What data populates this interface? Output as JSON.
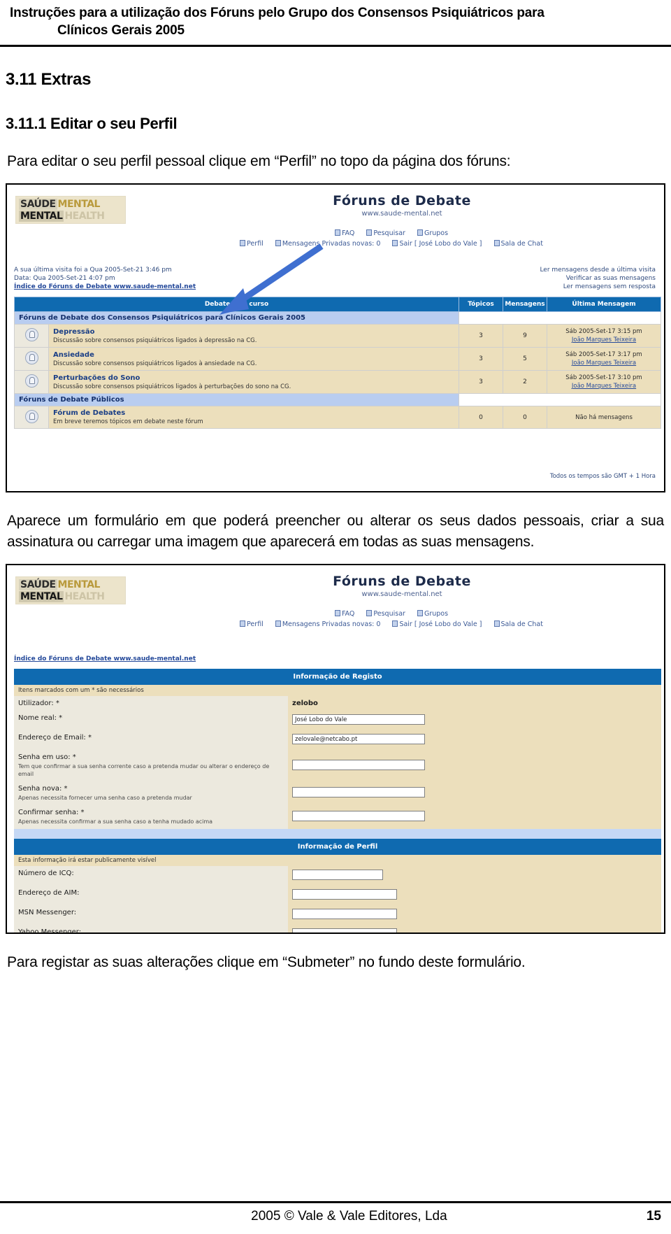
{
  "doc_header": {
    "line1": "Instruções para a utilização dos Fóruns pelo Grupo dos Consensos Psiquiátricos para",
    "line2": "Clínicos Gerais 2005"
  },
  "sections": {
    "h2": "3.11 Extras",
    "h3": "3.11.1 Editar o seu Perfil",
    "para1": "Para editar o seu perfil pessoal clique em “Perfil” no topo da página dos fóruns:",
    "para2": "Aparece um formulário em que poderá preencher ou alterar os seus dados pessoais, criar a sua assinatura ou carregar uma imagem que aparecerá em todas as suas mensagens.",
    "para3": "Para registar as suas alterações clique em “Submeter” no fundo deste formulário."
  },
  "logo": {
    "w1a": "SAÚDE",
    "w1b": "MENTAL",
    "w2a": "MENTAL",
    "w2b": "HEALTH"
  },
  "brand": {
    "title": "Fóruns de Debate",
    "url": "www.saude-mental.net"
  },
  "nav": {
    "row1": [
      {
        "label": "FAQ",
        "icon": "faq-icon"
      },
      {
        "label": "Pesquisar",
        "icon": "search-icon"
      },
      {
        "label": "Grupos",
        "icon": "groups-icon"
      }
    ],
    "row2": [
      {
        "label": "Perfil",
        "icon": "profile-icon"
      },
      {
        "label": "Mensagens Privadas novas: 0",
        "icon": "message-icon"
      },
      {
        "label": "Sair [ José Lobo do Vale ]",
        "icon": "logout-icon"
      },
      {
        "label": "Sala de Chat",
        "icon": "chat-icon"
      }
    ]
  },
  "status": {
    "last_visit": "A sua última visita foi a Qua 2005-Set-21 3:46 pm",
    "date": "Data: Qua 2005-Set-21 4:07 pm",
    "index_link": "Índice do Fóruns de Debate www.saude-mental.net",
    "right1": "Ler mensagens desde a última visita",
    "right2": "Verificar as suas mensagens",
    "right3": "Ler mensagens sem resposta"
  },
  "forum_table": {
    "headers": [
      "Debates em curso",
      "Tópicos",
      "Mensagens",
      "Última Mensagem"
    ],
    "category1": "Fóruns de Debate dos Consensos Psiquiátricos para Clínicos Gerais 2005",
    "category2": "Fóruns de Debate Públicos",
    "rows": [
      {
        "name": "Depressão",
        "desc": "Discussão sobre consensos psiquiátricos ligados à depressão na CG.",
        "topics": "3",
        "messages": "9",
        "last_date": "Sáb 2005-Set-17 3:15 pm",
        "last_author": "João Marques Teixeira"
      },
      {
        "name": "Ansiedade",
        "desc": "Discussão sobre consensos psiquiátricos ligados à ansiedade na CG.",
        "topics": "3",
        "messages": "5",
        "last_date": "Sáb 2005-Set-17 3:17 pm",
        "last_author": "João Marques Teixeira"
      },
      {
        "name": "Perturbações do Sono",
        "desc": "Discussão sobre consensos psiquiátricos ligados à perturbações do sono na CG.",
        "topics": "3",
        "messages": "2",
        "last_date": "Sáb 2005-Set-17 3:10 pm",
        "last_author": "João Marques Teixeira"
      }
    ],
    "public_row": {
      "name": "Fórum de Debates",
      "desc": "Em breve teremos tópicos em debate neste fórum",
      "topics": "0",
      "messages": "0",
      "last": "Não há mensagens"
    },
    "footer": "Todos os tempos são GMT + 1 Hora"
  },
  "profile_form": {
    "registration_bar": "Informação de Registo",
    "registration_note": "Itens marcados com um * são necessários",
    "fields": [
      {
        "label": "Utilizador: *",
        "value": "zelobo",
        "type": "text-plain",
        "hint": ""
      },
      {
        "label": "Nome real: *",
        "value": "José Lobo do Vale",
        "type": "input",
        "hint": ""
      },
      {
        "label": "Endereço de Email: *",
        "value": "zelovale@netcabo.pt",
        "type": "input",
        "hint": ""
      },
      {
        "label": "Senha em uso: *",
        "value": "",
        "type": "input",
        "hint": "Tem que confirmar a sua senha corrente caso a pretenda mudar ou alterar o endereço de email"
      },
      {
        "label": "Senha nova: *",
        "value": "",
        "type": "input",
        "hint": "Apenas necessita fornecer uma senha caso a pretenda mudar"
      },
      {
        "label": "Confirmar senha: *",
        "value": "",
        "type": "input",
        "hint": "Apenas necessita confirmar a sua senha caso a tenha mudado acima"
      }
    ],
    "profile_bar": "Informação de Perfil",
    "profile_note": "Esta informação irá estar publicamente visível",
    "profile_fields": [
      {
        "label": "Número de ICQ:",
        "value": "",
        "width": "w130"
      },
      {
        "label": "Endereço de AIM:",
        "value": "",
        "width": "w150"
      },
      {
        "label": "MSN Messenger:",
        "value": "",
        "width": "w150"
      },
      {
        "label": "Yahoo Messenger:",
        "value": "",
        "width": "w150"
      }
    ]
  },
  "doc_footer": {
    "copyright": "2005 © Vale & Vale Editores, Lda",
    "page": "15"
  },
  "colors": {
    "header_blue": "#0f6ab0",
    "category_blue": "#b9cdf0",
    "row_tan": "#ecdfbc",
    "arrow_blue": "#3f6fd0"
  }
}
